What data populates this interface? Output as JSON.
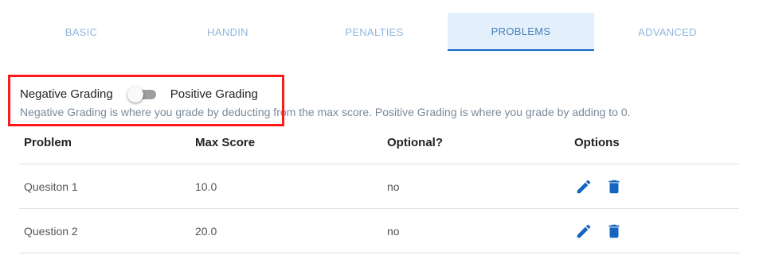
{
  "tabs": [
    {
      "label": "BASIC",
      "active": false
    },
    {
      "label": "HANDIN",
      "active": false
    },
    {
      "label": "PENALTIES",
      "active": false
    },
    {
      "label": "PROBLEMS",
      "active": true
    },
    {
      "label": "ADVANCED",
      "active": false
    }
  ],
  "grading": {
    "negative_label": "Negative Grading",
    "positive_label": "Positive Grading",
    "toggle_on": false,
    "hint": "Negative Grading is where you grade by deducting from the max score. Positive Grading is where you grade by adding to 0."
  },
  "table": {
    "headers": [
      "Problem",
      "Max Score",
      "Optional?",
      "Options"
    ],
    "rows": [
      {
        "problem": "Quesiton 1",
        "max_score": "10.0",
        "optional": "no"
      },
      {
        "problem": "Question 2",
        "max_score": "20.0",
        "optional": "no"
      }
    ]
  },
  "icons": {
    "edit": "pencil-icon",
    "delete": "trash-icon"
  },
  "colors": {
    "accent": "#1565c0",
    "highlight": "#ff1a1a",
    "tab_active_bg": "#e3f0fc"
  }
}
